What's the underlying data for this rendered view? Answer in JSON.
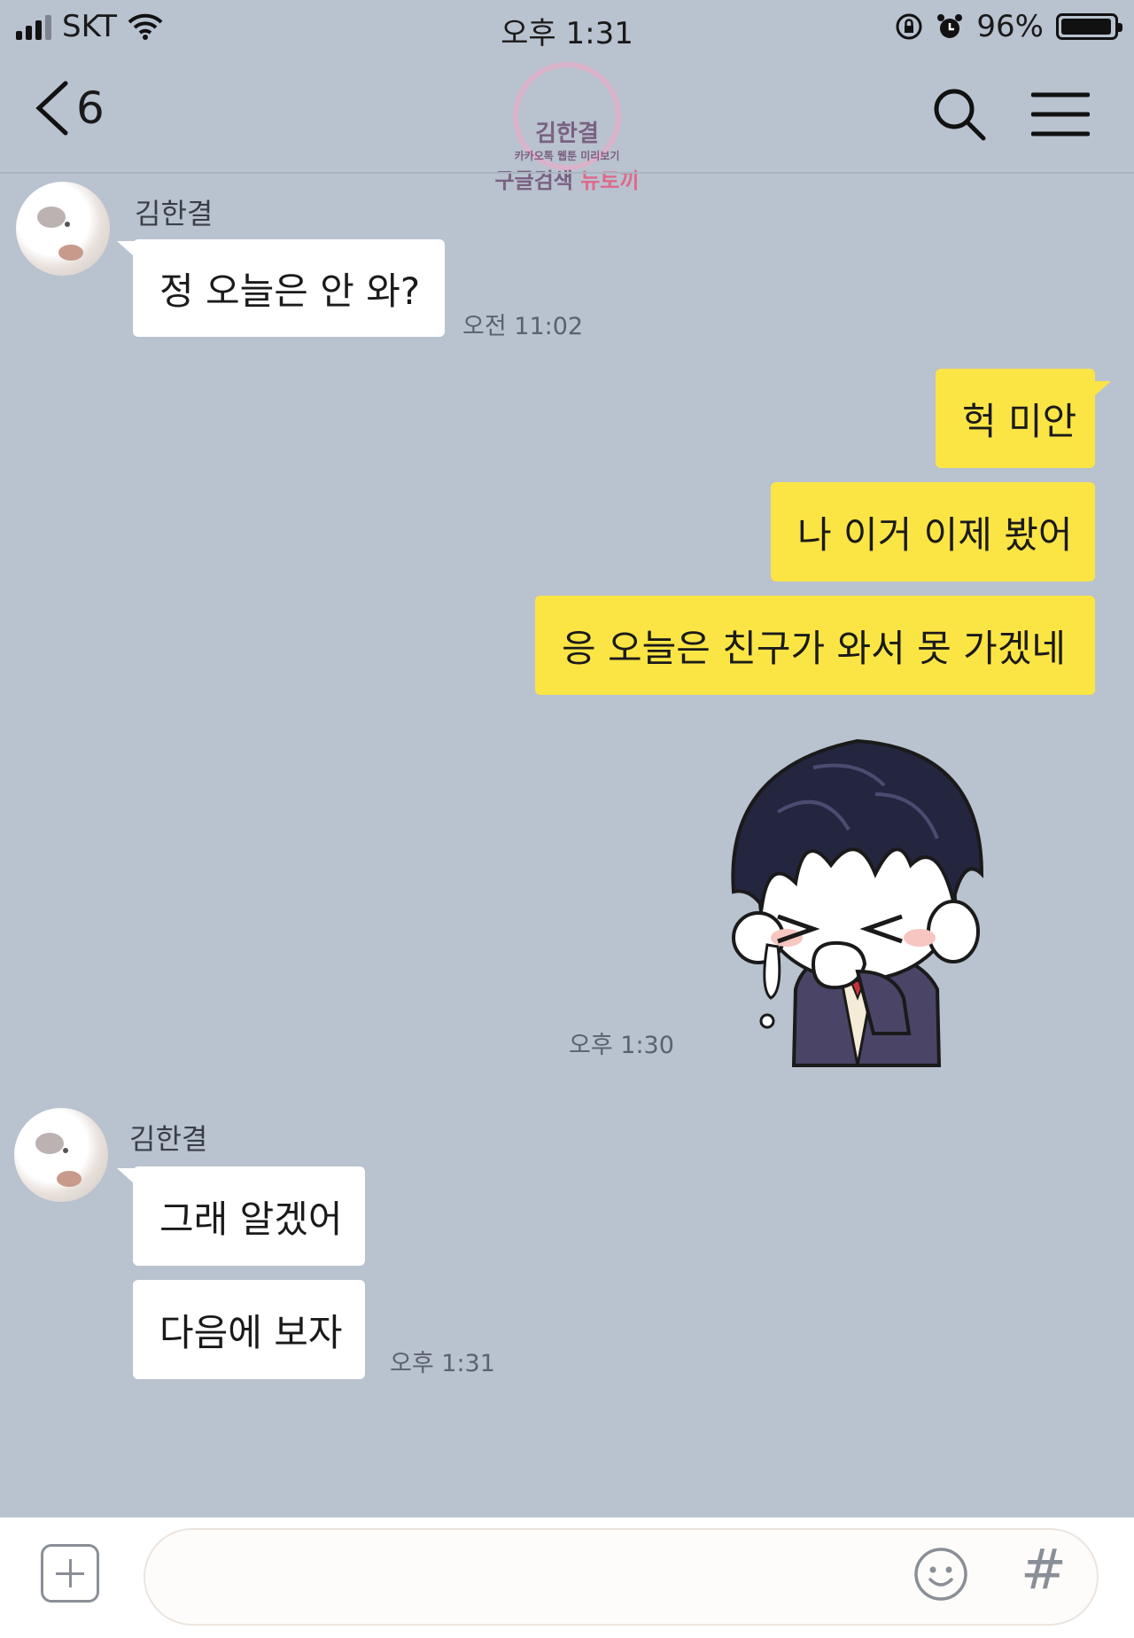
{
  "status_bar": {
    "carrier": "SKT",
    "time": "오후 1:31",
    "battery_percent": "96%",
    "battery_level": 0.96
  },
  "header": {
    "back_count": "6",
    "watermark_line1": "김한결",
    "watermark_line2": "카카오톡 웹툰 미리보기",
    "watermark_line3a": "구글검색",
    "watermark_line3b": "뉴토끼"
  },
  "messages": {
    "group1": {
      "sender": "김한결",
      "text": "정 오늘은 안 와?",
      "time": "오전 11:02"
    },
    "mine": {
      "line1": "헉 미안",
      "line2": "나 이거 이제 봤어",
      "line3": "응 오늘은 친구가 와서 못 가겠네",
      "sticker": "crying-boy-sticker",
      "time": "오후 1:30"
    },
    "group2": {
      "sender": "김한결",
      "line1": "그래 알겠어",
      "line2": "다음에 보자",
      "time": "오후 1:31"
    }
  },
  "input": {
    "placeholder": ""
  },
  "colors": {
    "background": "#b9c2cf",
    "my_bubble": "#fbe545",
    "their_bubble": "#ffffff"
  }
}
